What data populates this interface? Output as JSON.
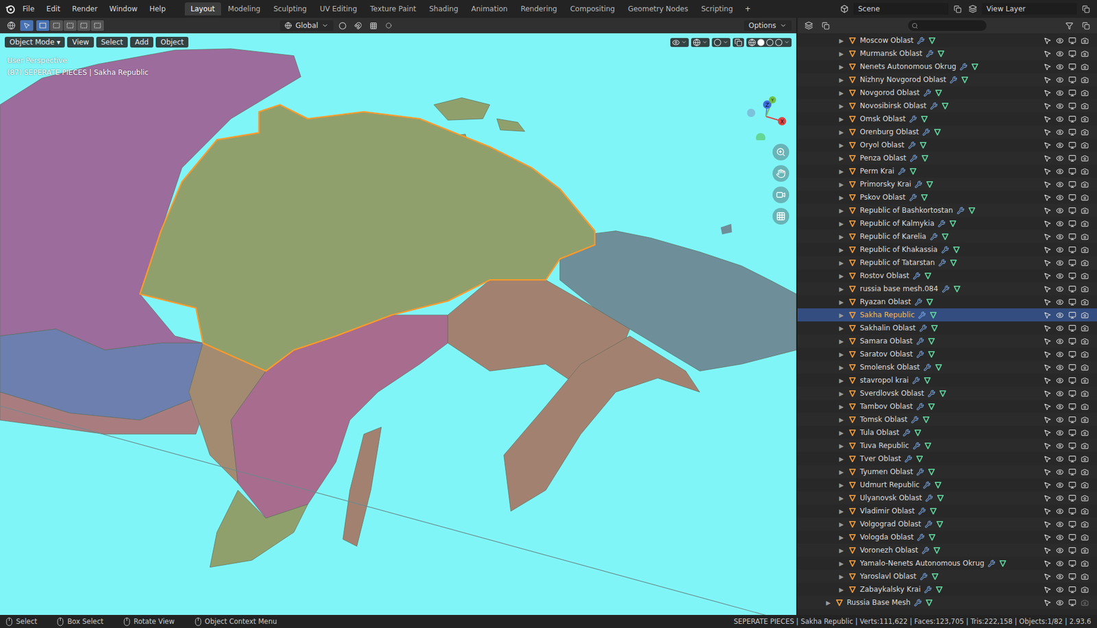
{
  "menubar": {
    "menus": [
      "File",
      "Edit",
      "Render",
      "Window",
      "Help"
    ]
  },
  "workspaces": [
    {
      "label": "Layout",
      "selected": true
    },
    {
      "label": "Modeling",
      "selected": false
    },
    {
      "label": "Sculpting",
      "selected": false
    },
    {
      "label": "UV Editing",
      "selected": false
    },
    {
      "label": "Texture Paint",
      "selected": false
    },
    {
      "label": "Shading",
      "selected": false
    },
    {
      "label": "Animation",
      "selected": false
    },
    {
      "label": "Rendering",
      "selected": false
    },
    {
      "label": "Compositing",
      "selected": false
    },
    {
      "label": "Geometry Nodes",
      "selected": false
    },
    {
      "label": "Scripting",
      "selected": false
    }
  ],
  "add_workspace": "+",
  "scene": "Scene",
  "view_layer": "View Layer",
  "tool_header": {
    "orientation": "Global",
    "options": "Options"
  },
  "viewport": {
    "mode": "Object Mode",
    "menus": [
      "View",
      "Select",
      "Add",
      "Object"
    ],
    "view_name": "User Perspective",
    "info": "(87) SEPERATE PIECES | Sakha Republic",
    "axes": [
      "Z",
      "Y",
      "X"
    ]
  },
  "outliner": {
    "rows": [
      {
        "name": "Moscow Oblast",
        "selected": false,
        "nested": true,
        "renderable": true
      },
      {
        "name": "Murmansk Oblast",
        "selected": false,
        "nested": true,
        "renderable": true
      },
      {
        "name": "Nenets Autonomous Okrug",
        "selected": false,
        "nested": true,
        "renderable": true
      },
      {
        "name": "Nizhny Novgorod Oblast",
        "selected": false,
        "nested": true,
        "renderable": true
      },
      {
        "name": "Novgorod Oblast",
        "selected": false,
        "nested": true,
        "renderable": true
      },
      {
        "name": "Novosibirsk Oblast",
        "selected": false,
        "nested": true,
        "renderable": true
      },
      {
        "name": "Omsk Oblast",
        "selected": false,
        "nested": true,
        "renderable": true
      },
      {
        "name": "Orenburg Oblast",
        "selected": false,
        "nested": true,
        "renderable": true
      },
      {
        "name": "Oryol Oblast",
        "selected": false,
        "nested": true,
        "renderable": true
      },
      {
        "name": "Penza Oblast",
        "selected": false,
        "nested": true,
        "renderable": true
      },
      {
        "name": "Perm Krai",
        "selected": false,
        "nested": true,
        "renderable": true
      },
      {
        "name": "Primorsky Krai",
        "selected": false,
        "nested": true,
        "renderable": true
      },
      {
        "name": "Pskov Oblast",
        "selected": false,
        "nested": true,
        "renderable": true
      },
      {
        "name": "Republic of Bashkortostan",
        "selected": false,
        "nested": true,
        "renderable": true
      },
      {
        "name": "Republic of Kalmykia",
        "selected": false,
        "nested": true,
        "renderable": true
      },
      {
        "name": "Republic of Karelia",
        "selected": false,
        "nested": true,
        "renderable": true
      },
      {
        "name": "Republic of Khakassia",
        "selected": false,
        "nested": true,
        "renderable": true
      },
      {
        "name": "Republic of Tatarstan",
        "selected": false,
        "nested": true,
        "renderable": true
      },
      {
        "name": "Rostov Oblast",
        "selected": false,
        "nested": true,
        "renderable": true
      },
      {
        "name": "russia base mesh.084",
        "selected": false,
        "nested": true,
        "renderable": true
      },
      {
        "name": "Ryazan Oblast",
        "selected": false,
        "nested": true,
        "renderable": true
      },
      {
        "name": "Sakha Republic",
        "selected": true,
        "nested": true,
        "renderable": true
      },
      {
        "name": "Sakhalin Oblast",
        "selected": false,
        "nested": true,
        "renderable": true
      },
      {
        "name": "Samara Oblast",
        "selected": false,
        "nested": true,
        "renderable": true
      },
      {
        "name": "Saratov Oblast",
        "selected": false,
        "nested": true,
        "renderable": true
      },
      {
        "name": "Smolensk Oblast",
        "selected": false,
        "nested": true,
        "renderable": true
      },
      {
        "name": "stavropol krai",
        "selected": false,
        "nested": true,
        "renderable": true
      },
      {
        "name": "Sverdlovsk Oblast",
        "selected": false,
        "nested": true,
        "renderable": true
      },
      {
        "name": "Tambov Oblast",
        "selected": false,
        "nested": true,
        "renderable": true
      },
      {
        "name": "Tomsk Oblast",
        "selected": false,
        "nested": true,
        "renderable": true
      },
      {
        "name": "Tula Oblast",
        "selected": false,
        "nested": true,
        "renderable": true
      },
      {
        "name": "Tuva Republic",
        "selected": false,
        "nested": true,
        "renderable": true
      },
      {
        "name": "Tver Oblast",
        "selected": false,
        "nested": true,
        "renderable": true
      },
      {
        "name": "Tyumen Oblast",
        "selected": false,
        "nested": true,
        "renderable": true
      },
      {
        "name": "Udmurt Republic",
        "selected": false,
        "nested": true,
        "renderable": true
      },
      {
        "name": "Ulyanovsk Oblast",
        "selected": false,
        "nested": true,
        "renderable": true
      },
      {
        "name": "Vladimir Oblast",
        "selected": false,
        "nested": true,
        "renderable": true
      },
      {
        "name": "Volgograd Oblast",
        "selected": false,
        "nested": true,
        "renderable": true
      },
      {
        "name": "Vologda Oblast",
        "selected": false,
        "nested": true,
        "renderable": true
      },
      {
        "name": "Voronezh Oblast",
        "selected": false,
        "nested": true,
        "renderable": true
      },
      {
        "name": "Yamalo-Nenets Autonomous Okrug",
        "selected": false,
        "nested": true,
        "renderable": true
      },
      {
        "name": "Yaroslavl Oblast",
        "selected": false,
        "nested": true,
        "renderable": true
      },
      {
        "name": "Zabaykalsky Krai",
        "selected": false,
        "nested": true,
        "renderable": true
      },
      {
        "name": "Russia Base Mesh",
        "selected": false,
        "nested": false,
        "renderable": false
      }
    ]
  },
  "status_bar": {
    "hints": [
      "Select",
      "Box Select",
      "Rotate View",
      "Object Context Menu"
    ],
    "stats": "SEPERATE PIECES | Sakha Republic | Verts:111,622 | Faces:123,705 | Tris:222,158 | Objects:1/82 | 2.93.6"
  }
}
